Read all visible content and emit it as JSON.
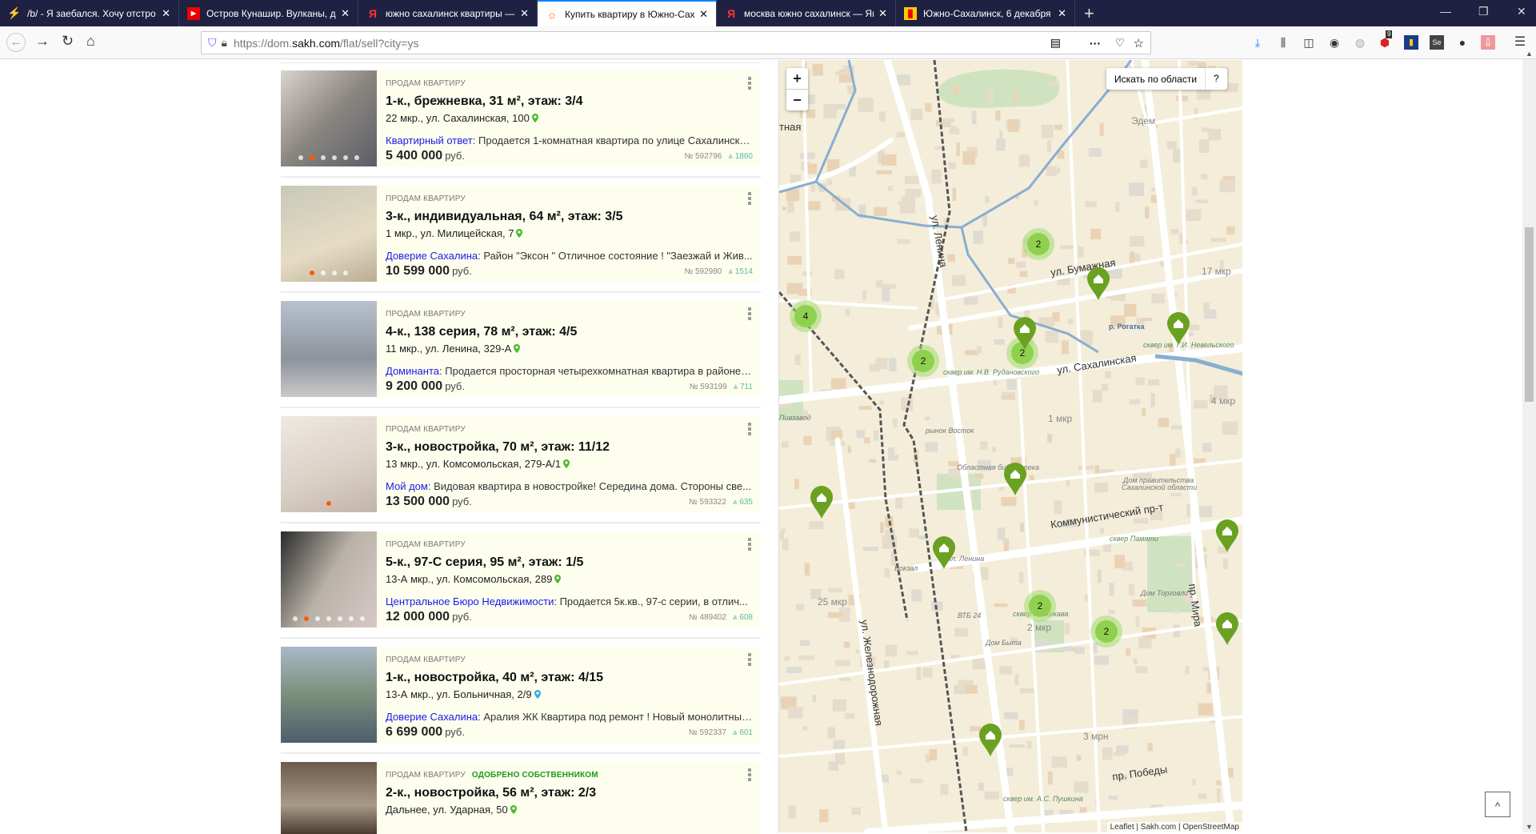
{
  "browser": {
    "tabs": [
      {
        "title": "/b/ - Я заебался. Хочу отстро",
        "icon": "lightning-icon"
      },
      {
        "title": "Остров Кунашир. Вулканы, д",
        "icon": "youtube-icon"
      },
      {
        "title": "южно сахалинск квартиры — Я",
        "icon": "yandex-icon"
      },
      {
        "title": "Купить квартиру в Южно-Сах",
        "icon": "sakh-icon"
      },
      {
        "title": "москва южно сахалинск — Ян",
        "icon": "yandex-icon"
      },
      {
        "title": "Южно-Сахалинск, 6 декабря",
        "icon": "news-icon"
      }
    ],
    "active_tab": 3,
    "url_prefix": "https://dom.",
    "url_domain": "sakh.com",
    "url_path": "/flat/sell?city=ys",
    "ublock_badge": "9"
  },
  "listings": [
    {
      "kind": "ПРОДАМ КВАРТИРУ",
      "approved": "",
      "title": "1-к., брежневка, 31 м², этаж: 3/4",
      "address": "22 мкр., ул. Сахалинская, 100",
      "agency": "Квартирный ответ",
      "desc": ": Продается 1-комнатная квартира по улице Сахалинско...",
      "price": "5 400 000",
      "currency": "руб.",
      "id": "№ 592796",
      "views": "1860",
      "photos": 6,
      "active_photo": 1,
      "pin_color": "#4cb82c"
    },
    {
      "kind": "ПРОДАМ КВАРТИРУ",
      "approved": "",
      "title": "3-к., индивидуальная, 64 м², этаж: 3/5",
      "address": "1 мкр., ул. Милицейская, 7",
      "agency": "Доверие Сахалина",
      "desc": ": Район \"Эксон \" Отличное состояние ! \"Заезжай и Жив...",
      "price": "10 599 000",
      "currency": "руб.",
      "id": "№ 592980",
      "views": "1514",
      "photos": 4,
      "active_photo": 0,
      "pin_color": "#4cb82c"
    },
    {
      "kind": "ПРОДАМ КВАРТИРУ",
      "approved": "",
      "title": "4-к., 138 серия, 78 м², этаж: 4/5",
      "address": "11 мкр., ул. Ленина, 329-А",
      "agency": "Доминанта",
      "desc": ": Продается просторная четырехкомнатная квартира в районе г...",
      "price": "9 200 000",
      "currency": "руб.",
      "id": "№ 593199",
      "views": "711",
      "photos": 0,
      "active_photo": 0,
      "pin_color": "#4cb82c"
    },
    {
      "kind": "ПРОДАМ КВАРТИРУ",
      "approved": "",
      "title": "3-к., новостройка, 70 м², этаж: 11/12",
      "address": "13 мкр., ул. Комсомольская, 279-А/1",
      "agency": "Мой дом",
      "desc": ": Видовая квартира в новостройке! Середина дома. Стороны све...",
      "price": "13 500 000",
      "currency": "руб.",
      "id": "№ 593322",
      "views": "635",
      "photos": 1,
      "active_photo": 0,
      "pin_color": "#4cb82c"
    },
    {
      "kind": "ПРОДАМ КВАРТИРУ",
      "approved": "",
      "title": "5-к., 97-С серия, 95 м², этаж: 1/5",
      "address": "13-А мкр., ул. Комсомольская, 289",
      "agency": "Центральное Бюро Недвижимости",
      "desc": ": Продается 5к.кв., 97-с серии, в отлич...",
      "price": "12 000 000",
      "currency": "руб.",
      "id": "№ 489402",
      "views": "608",
      "photos": 7,
      "active_photo": 1,
      "pin_color": "#4cb82c"
    },
    {
      "kind": "ПРОДАМ КВАРТИРУ",
      "approved": "",
      "title": "1-к., новостройка, 40 м², этаж: 4/15",
      "address": "13-А мкр., ул. Больничная, 2/9",
      "agency": "Доверие Сахалина",
      "desc": ": Аралия ЖК Квартира под ремонт ! Новый монолитный...",
      "price": "6 699 000",
      "currency": "руб.",
      "id": "№ 592337",
      "views": "601",
      "photos": 0,
      "active_photo": 0,
      "pin_color": "#3aa8e0"
    },
    {
      "kind": "ПРОДАМ КВАРТИРУ",
      "approved": "ОДОБРЕНО СОБСТВЕННИКОМ",
      "title": "2-к., новостройка, 56 м², этаж: 2/3",
      "address": "Дальнее, ул. Ударная, 50",
      "agency": "",
      "desc": "",
      "price": "",
      "currency": "",
      "id": "",
      "views": "",
      "photos": 0,
      "active_photo": 0,
      "pin_color": "#4cb82c"
    }
  ],
  "map": {
    "zoom_in": "+",
    "zoom_out": "−",
    "search_area": "Искать по области",
    "help": "?",
    "attribution": "Leaflet | Sakh.com | OpenStreetMap",
    "clusters": [
      "2",
      "4",
      "2",
      "2",
      "2",
      "2"
    ],
    "streets": [
      "ул. Ленина",
      "ул. Бумажная",
      "ул. Сахалинская",
      "Коммунистический пр-т",
      "ул. Железнодорожная",
      "пр. Мира",
      "пр. Победы",
      "тная"
    ],
    "districts": [
      "17 мкр",
      "4 мкр",
      "1 мкр",
      "25 мкр",
      "2 мкр",
      "3 мрн",
      "Эдем"
    ],
    "pois": [
      "Областная библиотека",
      "Дом правительства",
      "Сахалинской области",
      "Вокзал",
      "пл. Ленина",
      "ВТБ 24",
      "сквер Асахикава",
      "Дом Быта",
      "Дом Торговли",
      "сквер Памяти",
      "сквер им. А.С. Пушкина",
      "р. Рогатка",
      "сквер им. Н.В. Рудановского",
      "сквер им. Г.И. Невельского",
      "рынок Восток",
      "Пивзавод"
    ]
  },
  "page": {
    "back_to_top": "^"
  },
  "colors": {
    "card_bg": "#fefeee",
    "agency": "#1a1aee",
    "pin": "#6aa121",
    "cluster": "#8fd14f"
  }
}
